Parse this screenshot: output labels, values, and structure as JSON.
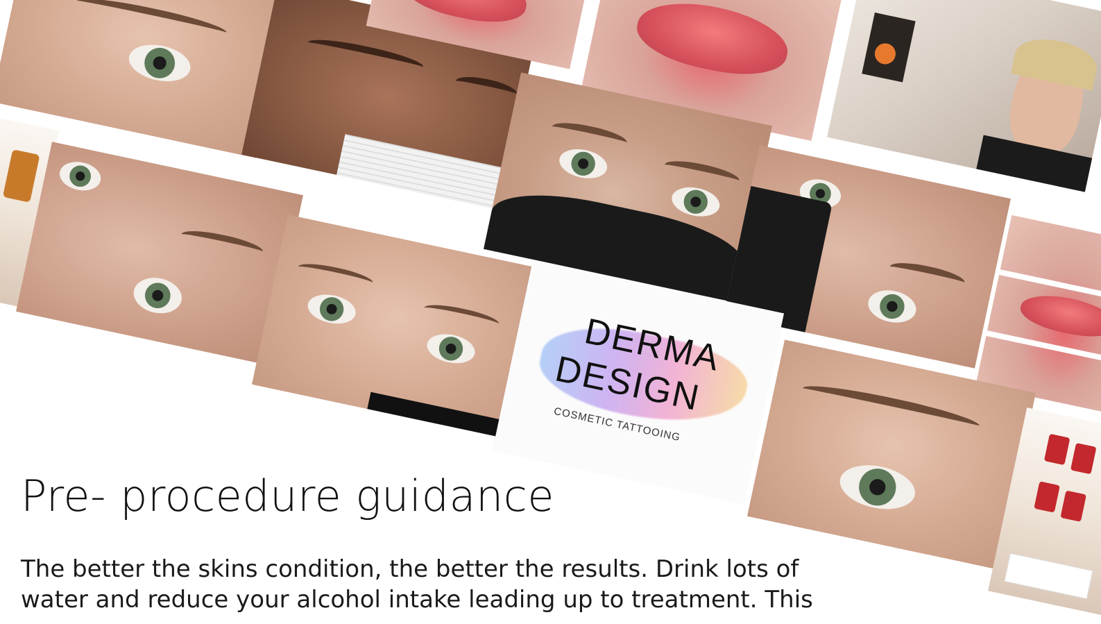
{
  "page": {
    "title": "Pre- procedure guidance",
    "body": "The better the skins condition, the better the results. Drink lots of water and reduce your alcohol intake leading up to treatment. This"
  },
  "logo": {
    "line1": "DERMA",
    "line2": "DESIGN",
    "tagline": "COSMETIC TATTOOING"
  },
  "gallery": {
    "photos": [
      "eyelash-closeup-photo",
      "brow-photo-dark-skin",
      "lip-photo-top",
      "lip-photo-large",
      "salon-selfie-photo",
      "shelf-products-left-photo",
      "brow-side-photo",
      "brow-front-photo-white-mask",
      "brows-eyes-black-mask-photo",
      "brow-eye-black-mask-side-photo",
      "lips-collage-photo",
      "brow-eye-lashes-photo",
      "product-shelf-photo"
    ]
  },
  "colors": {
    "background": "#ffffff",
    "text": "#111111",
    "brow": "#6b4a36"
  }
}
